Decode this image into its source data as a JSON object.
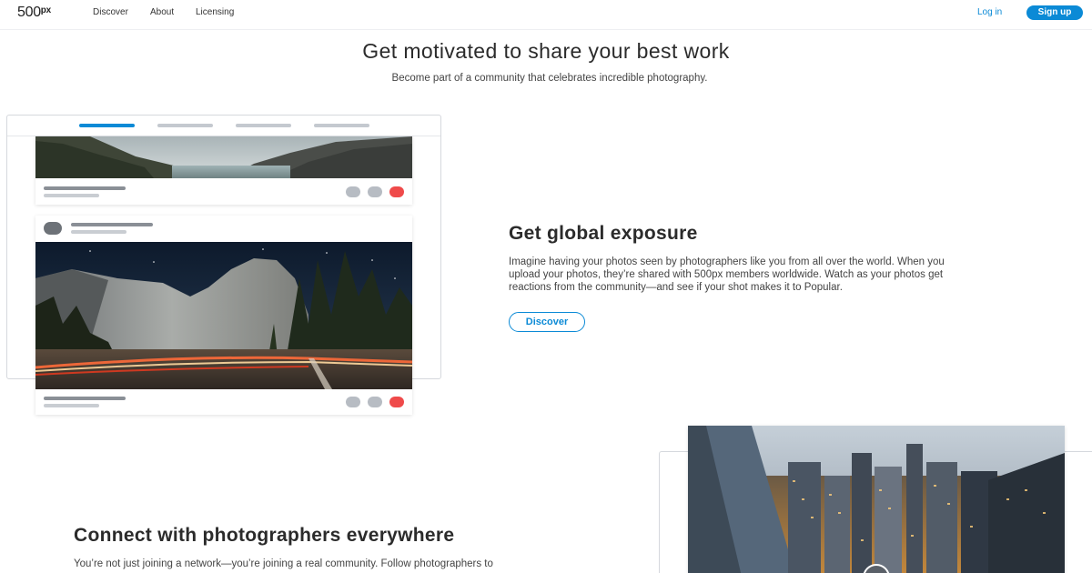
{
  "nav": {
    "logo_main": "500",
    "logo_sup": "px",
    "links": [
      "Discover",
      "About",
      "Licensing"
    ],
    "login_label": "Log in",
    "signup_label": "Sign up"
  },
  "hero": {
    "title": "Get motivated to share your best work",
    "subtitle": "Become part of a community that celebrates incredible photography."
  },
  "exposure": {
    "title": "Get global exposure",
    "body_lines": [
      "Imagine having your photos seen by photographers like you from all over the world. When you",
      "upload your photos, they’re shared with 500px members worldwide. Watch as your photos get",
      "reactions from the community—and see if your shot makes it to Popular."
    ],
    "button_label": "Discover"
  },
  "connect": {
    "title": "Connect with photographers everywhere",
    "body_line": "You’re not just joining a network—you’re joining a real community. Follow photographers to"
  },
  "colors": {
    "accent": "#0b8ad6",
    "like_red": "#ef4a4a",
    "placeholder_grey": "#c9cdd2"
  }
}
